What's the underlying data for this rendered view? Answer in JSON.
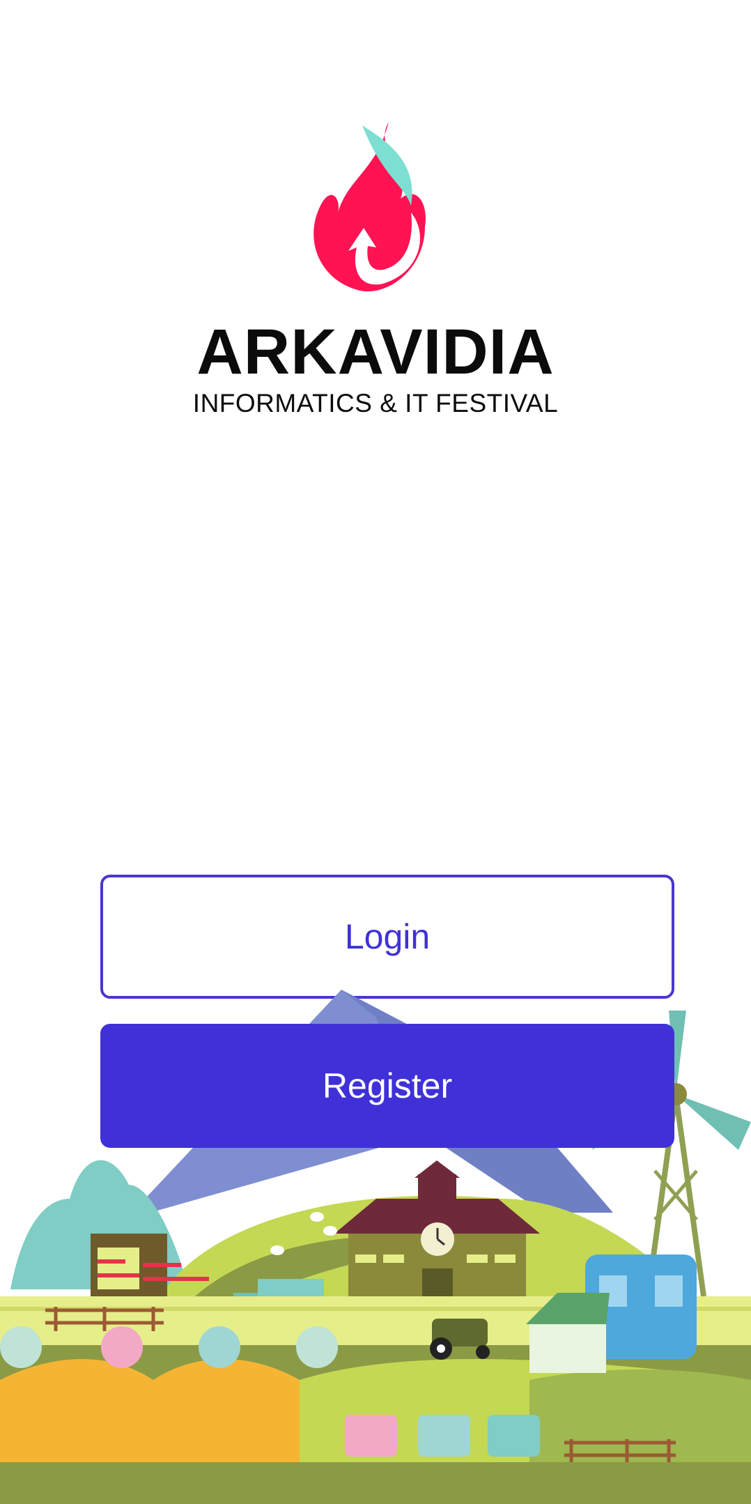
{
  "brand": {
    "title": "ARKAVIDIA",
    "subtitle": "INFORMATICS & IT FESTIVAL",
    "colors": {
      "flame": "#ff1353",
      "flame_accent": "#7ddfd2"
    }
  },
  "auth": {
    "login_label": "Login",
    "register_label": "Register",
    "colors": {
      "primary": "#3f31d7",
      "outline": "#4a36cf"
    }
  },
  "scene": {
    "clock_label": "clock-face",
    "colors": {
      "grass": "#c4d854",
      "field": "#e6ee8a",
      "mountain": "#7f8ed0",
      "barn": "#6e2a3a",
      "tower": "#8fa052"
    }
  }
}
